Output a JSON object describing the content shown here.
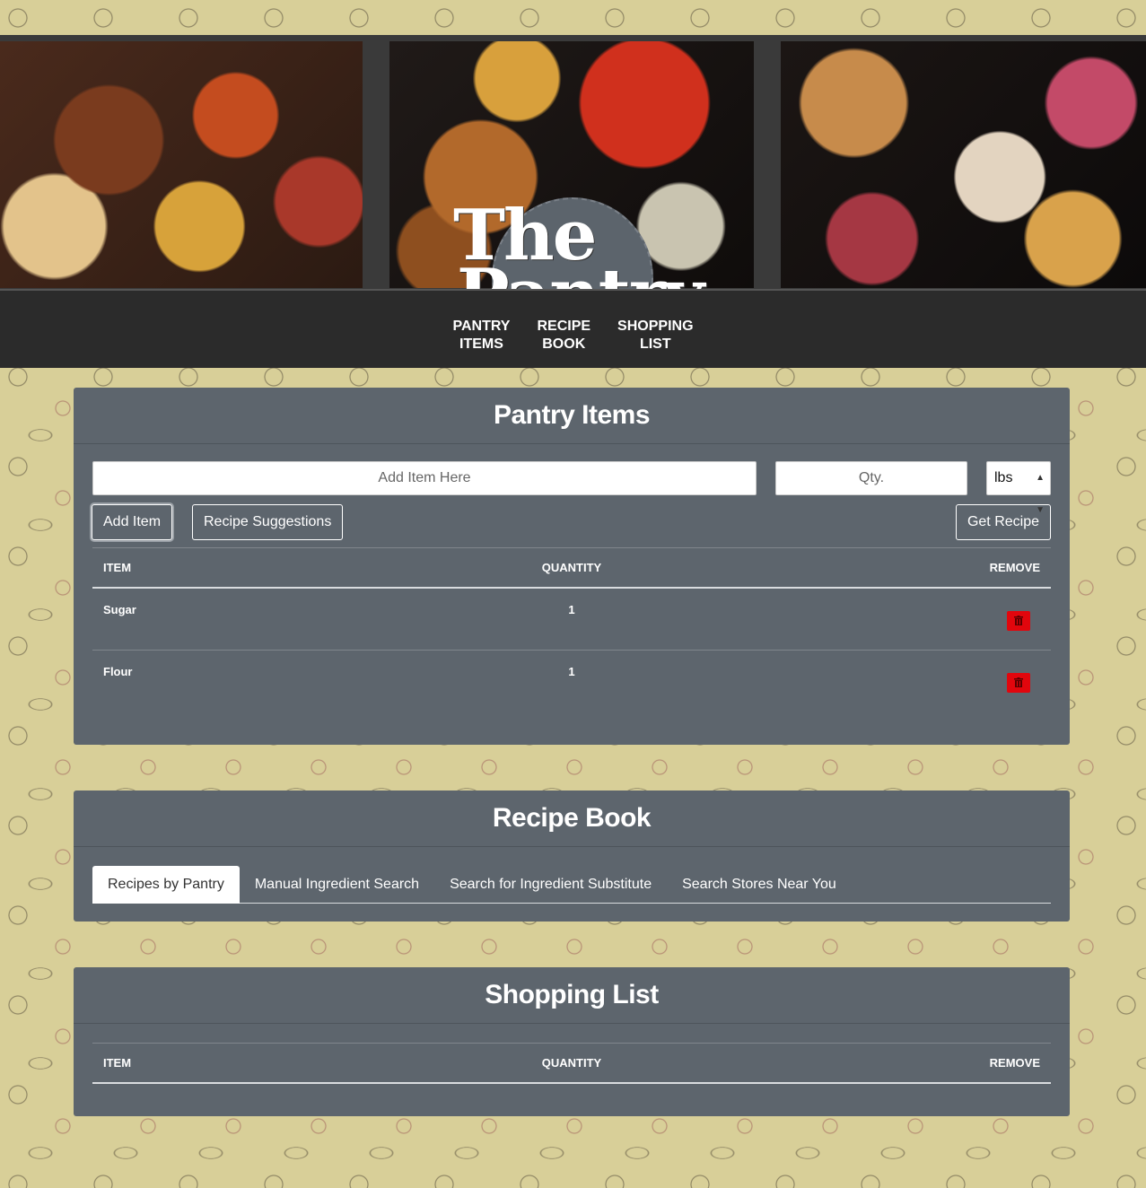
{
  "header": {
    "logo_line1": "The",
    "logo_line2": "Pantry"
  },
  "nav": {
    "links": [
      "PANTRY\nITEMS",
      "RECIPE\nBOOK",
      "SHOPPING\nLIST"
    ]
  },
  "pantry": {
    "title": "Pantry Items",
    "item_placeholder": "Add Item Here",
    "qty_placeholder": "Qty.",
    "unit_selected": "lbs",
    "add_button": "Add Item",
    "suggestions_button": "Recipe Suggestions",
    "get_recipe_button": "Get Recipe",
    "columns": [
      "ITEM",
      "QUANTITY",
      "REMOVE"
    ],
    "rows": [
      {
        "item": "Sugar",
        "quantity": "1"
      },
      {
        "item": "Flour",
        "quantity": "1"
      }
    ]
  },
  "recipe_book": {
    "title": "Recipe Book",
    "tabs": [
      "Recipes by Pantry",
      "Manual Ingredient Search",
      "Search for Ingredient Substitute",
      "Search Stores Near You"
    ],
    "active_tab": 0
  },
  "shopping": {
    "title": "Shopping List",
    "columns": [
      "ITEM",
      "QUANTITY",
      "REMOVE"
    ]
  },
  "icons": {
    "trash": "trash-icon",
    "select_arrow": "select-arrows-icon"
  },
  "colors": {
    "panel": "#5d656d",
    "navbar": "#2b2b2b",
    "background": "#d8cf98",
    "delete": "#e1060d"
  }
}
